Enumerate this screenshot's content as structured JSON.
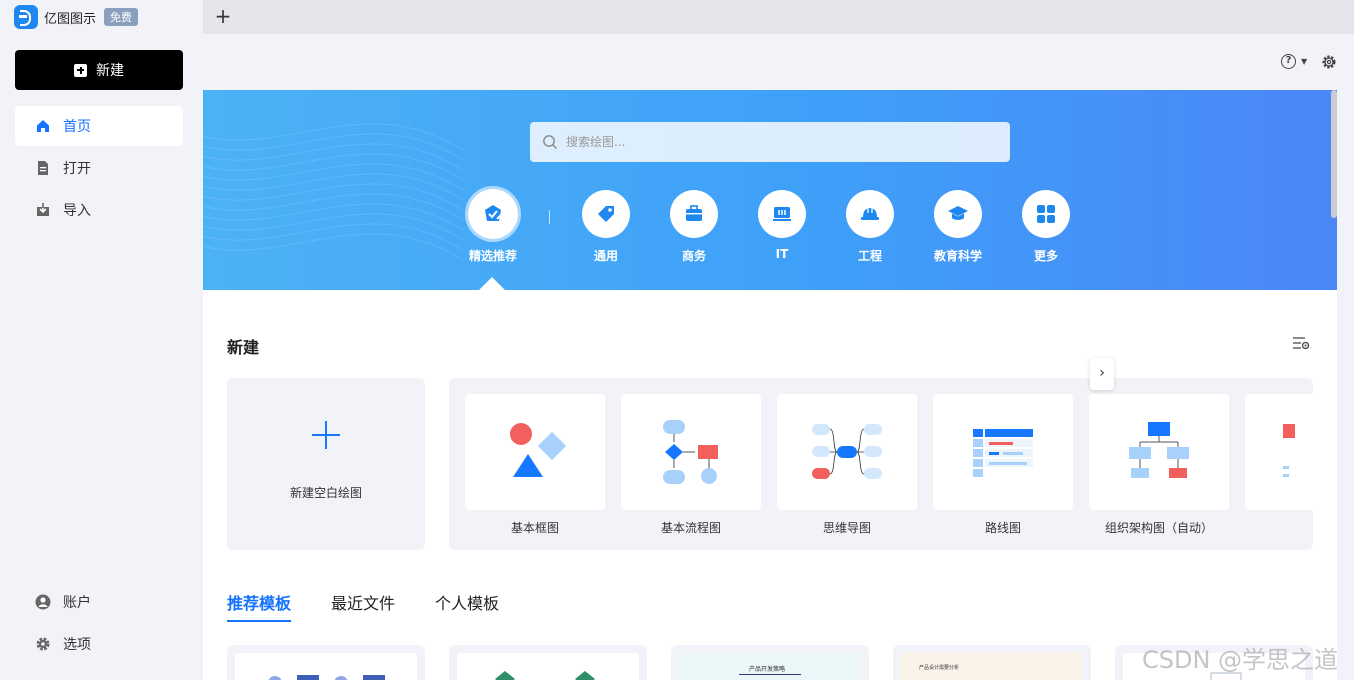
{
  "tab": {
    "app_name": "亿图图示",
    "badge": "免费",
    "new_tab": "+"
  },
  "sidebar": {
    "new_label": "新建",
    "items": [
      {
        "label": "首页",
        "icon": "home-icon",
        "active": true
      },
      {
        "label": "打开",
        "icon": "file-icon"
      },
      {
        "label": "导入",
        "icon": "import-icon"
      }
    ],
    "bottom": [
      {
        "label": "账户",
        "icon": "user-icon"
      },
      {
        "label": "选项",
        "icon": "gear-icon"
      }
    ]
  },
  "header": {
    "help": "?"
  },
  "banner": {
    "search_placeholder": "搜索绘图...",
    "categories": [
      {
        "label": "精选推荐",
        "icon": "featured-icon",
        "selected": true
      },
      {
        "label": "通用",
        "icon": "tag-icon"
      },
      {
        "label": "商务",
        "icon": "briefcase-icon"
      },
      {
        "label": "IT",
        "icon": "monitor-icon"
      },
      {
        "label": "工程",
        "icon": "helmet-icon"
      },
      {
        "label": "教育科学",
        "icon": "graduation-icon"
      },
      {
        "label": "更多",
        "icon": "grid-icon"
      }
    ]
  },
  "new_section": {
    "title": "新建",
    "blank_label": "新建空白绘图",
    "templates": [
      "基本框图",
      "基本流程图",
      "思维导图",
      "路线图",
      "组织架构图（自动）"
    ]
  },
  "bottom_tabs": [
    "推荐模板",
    "最近文件",
    "个人模板"
  ],
  "template_previews": [
    "产品开发策略",
    "产品设计需要分析"
  ],
  "watermark": "CSDN @学思之道",
  "colors": {
    "accent": "#1673ff",
    "banner_start": "#4cb2f6",
    "banner_end": "#4b86f7"
  }
}
